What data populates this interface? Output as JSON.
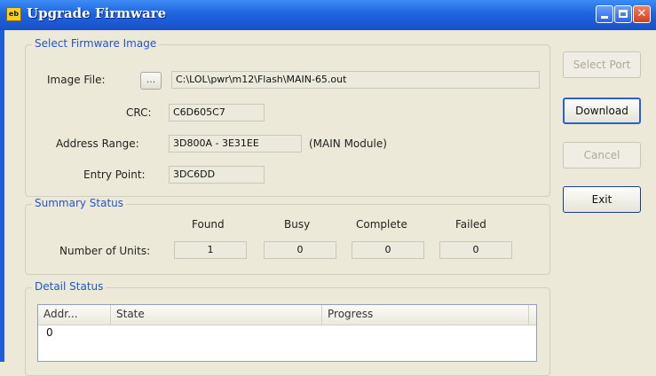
{
  "window": {
    "title": "Upgrade Firmware",
    "app_icon_text": "eb"
  },
  "select_image": {
    "legend": "Select Firmware Image",
    "image_file_label": "Image File:",
    "browse_label": "...",
    "image_file_value": "C:\\LOL\\pwr\\m12\\Flash\\MAIN-65.out",
    "crc_label": "CRC:",
    "crc_value": "C6D605C7",
    "address_range_label": "Address Range:",
    "address_range_value": "3D800A - 3E31EE",
    "address_range_note": "(MAIN Module)",
    "entry_point_label": "Entry Point:",
    "entry_point_value": "3DC6DD"
  },
  "summary": {
    "legend": "Summary Status",
    "row_label": "Number of Units:",
    "columns": [
      "Found",
      "Busy",
      "Complete",
      "Failed"
    ],
    "values": [
      "1",
      "0",
      "0",
      "0"
    ]
  },
  "detail": {
    "legend": "Detail Status",
    "columns": [
      "Addr...",
      "State",
      "Progress"
    ],
    "rows": [
      {
        "addr": "0",
        "state": "",
        "progress": ""
      }
    ]
  },
  "buttons": {
    "select_port": "Select Port",
    "download": "Download",
    "cancel": "Cancel",
    "exit": "Exit"
  }
}
